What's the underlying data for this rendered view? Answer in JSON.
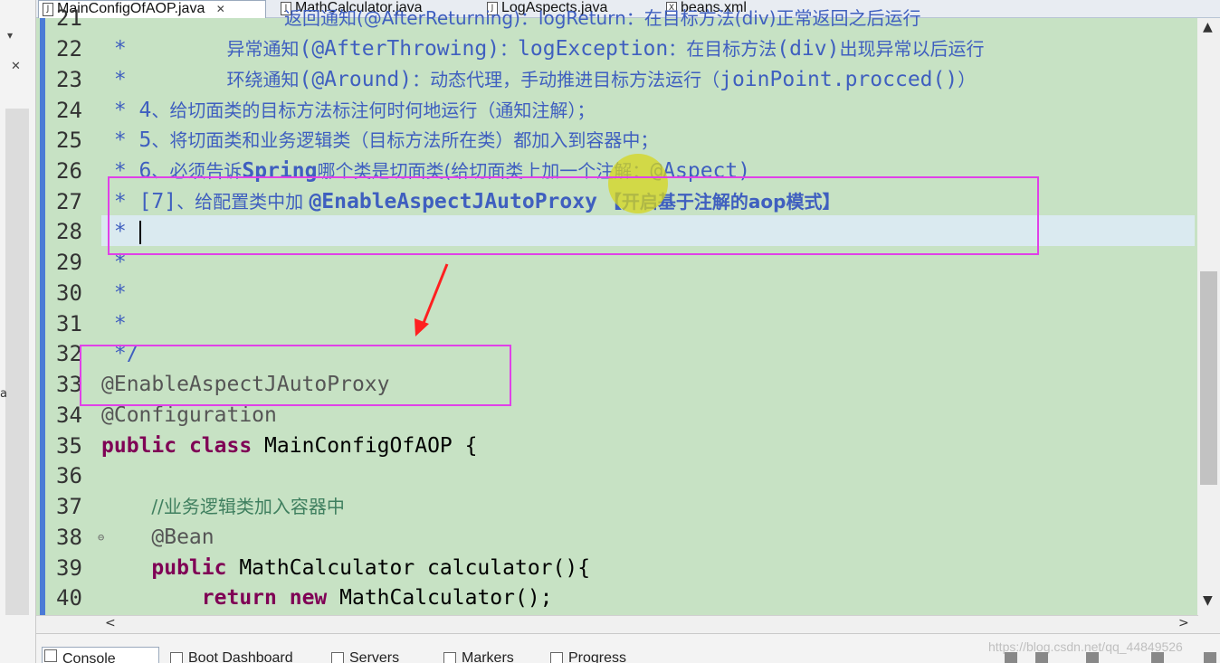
{
  "tabs": [
    {
      "label": "MainConfigOfAOP.java",
      "icon": "java-file-icon",
      "active": true
    },
    {
      "label": "MathCalculator.java",
      "icon": "java-file-icon",
      "active": false
    },
    {
      "label": "LogAspects.java",
      "icon": "java-file-icon",
      "active": false
    },
    {
      "label": "beans.xml",
      "icon": "xml-file-icon",
      "active": false
    }
  ],
  "tab_close_glyph": "✕",
  "editor": {
    "line_numbers": [
      "21",
      "22",
      "23",
      "24",
      "25",
      "26",
      "27",
      "28",
      "29",
      "30",
      "31",
      "32",
      "33",
      "34",
      "35",
      "36",
      "37",
      "38",
      "39",
      "40"
    ],
    "line21": {
      "text": "返回通知(@AfterReturning)：logReturn：在目标方法(div)正常返回之后运行"
    },
    "line22": {
      "star": " *",
      "lead": "        ",
      "pre": "异常通知",
      "code1": "(@AfterThrowing)",
      "mid1": "：",
      "code2": "logException",
      "mid2": "：在目标方法",
      "code3": "(div)",
      "post": "出现异常以后运行"
    },
    "line23": {
      "star": " *",
      "lead": "        ",
      "pre": "环绕通知",
      "code1": "(@Around)",
      "mid1": "：动态代理，手动推进目标方法运行（",
      "code2": "joinPoint.procced()",
      "post": "）"
    },
    "line24": {
      "star": " * ",
      "num": "4",
      "text": "、给切面类的目标方法标注何时何地运行（通知注解）；"
    },
    "line25": {
      "star": " * ",
      "num": "5",
      "text": "、将切面类和业务逻辑类（目标方法所在类）都加入到容器中；"
    },
    "line26": {
      "star": " * ",
      "num": "6",
      "pre": "、必须告诉",
      "code1": "Spring",
      "mid": "哪个类是切面类(给切面类上加一个注解：",
      "code2": "@Aspect",
      "post": ")"
    },
    "line27": {
      "star": " * ",
      "num": "[7]",
      "pre": "、给配置类中加 ",
      "code": "@EnableAspectJAutoProxy",
      "post": " 【开启基于注解的aop模式】"
    },
    "line28": {
      "star": " * "
    },
    "line29": {
      "star": " *"
    },
    "line30": {
      "star": " *"
    },
    "line31": {
      "star": " *"
    },
    "line32": {
      "text": " */"
    },
    "line33": {
      "text": "@EnableAspectJAutoProxy"
    },
    "line34": {
      "text": "@Configuration"
    },
    "line35": {
      "kw1": "public",
      "kw2": "class",
      "rest": " MainConfigOfAOP {"
    },
    "line37": {
      "lead": "    ",
      "text": "//业务逻辑类加入容器中"
    },
    "line38": {
      "lead": "    ",
      "text": "@Bean"
    },
    "line39": {
      "lead": "    ",
      "kw": "public",
      "rest": " MathCalculator calculator(){"
    },
    "line40": {
      "lead": "        ",
      "kw1": "return",
      "kw2": "new",
      "rest": " MathCalculator();"
    },
    "fold_glyph": "⊖"
  },
  "bottom_tabs": [
    {
      "label": "Console",
      "icon": "console-icon",
      "active": true
    },
    {
      "label": "Boot Dashboard",
      "icon": "boot-dashboard-icon",
      "active": false
    },
    {
      "label": "Servers",
      "icon": "servers-icon",
      "active": false
    },
    {
      "label": "Markers",
      "icon": "markers-icon",
      "active": false
    },
    {
      "label": "Progress",
      "icon": "progress-icon",
      "active": false
    }
  ],
  "watermark": "https://blog.csdn.net/qq_44849526",
  "left_panel": {
    "char": "a",
    "minimize": "▾",
    "restore": "✕"
  },
  "scroll": {
    "up": "▲",
    "down": "▼",
    "left": "<",
    "right": ">"
  },
  "colors": {
    "editor_bg": "#c7e2c4",
    "highlight_box": "#e040e8",
    "arrow": "#ff2020",
    "comment": "#3f5fbf",
    "keyword": "#7f0055"
  }
}
